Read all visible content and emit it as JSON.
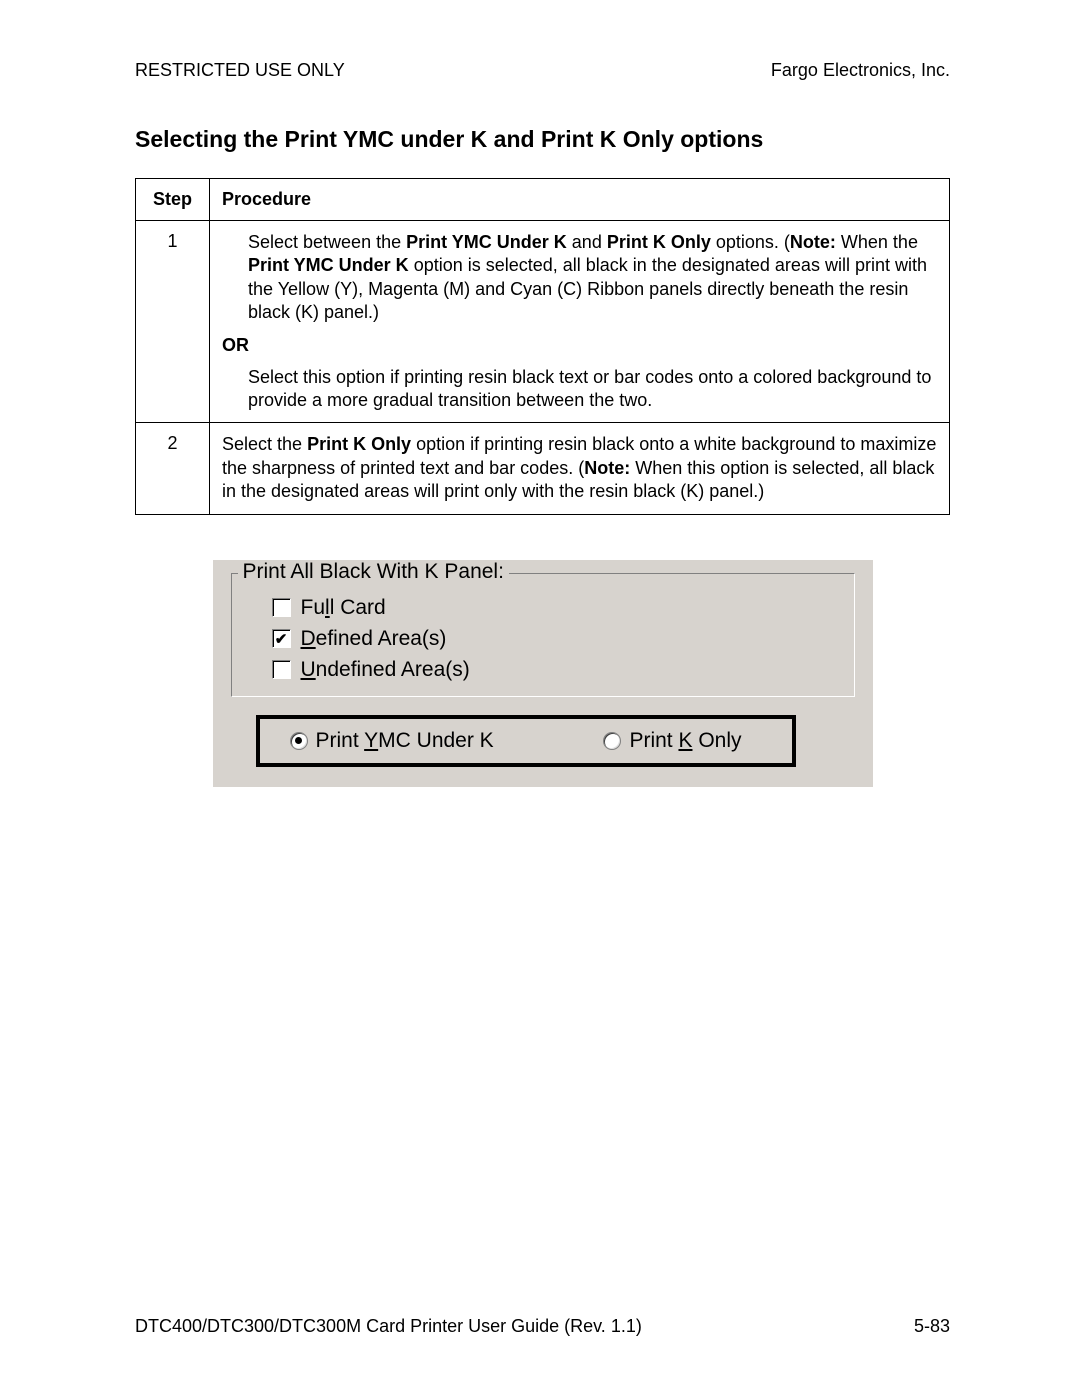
{
  "header": {
    "left": "RESTRICTED USE ONLY",
    "right": "Fargo Electronics, Inc."
  },
  "title": "Selecting the Print YMC under K and Print K Only options",
  "table": {
    "headers": {
      "step": "Step",
      "procedure": "Procedure"
    },
    "rows": [
      {
        "step": "1",
        "para1_pre": "Select between the ",
        "para1_b1": "Print YMC Under K",
        "para1_mid1": " and ",
        "para1_b2": "Print K Only",
        "para1_mid2": " options. (",
        "para1_b3": "Note:",
        "para1_mid3": " When the ",
        "para1_b4": "Print YMC Under K",
        "para1_post": " option is selected, all black in the designated areas will print with the Yellow (Y), Magenta (M) and Cyan (C) Ribbon panels directly beneath the resin black (K) panel.)",
        "or": "OR",
        "para2": "Select this option if printing resin black text or bar codes onto a colored background to provide a more gradual transition between the two."
      },
      {
        "step": "2",
        "para_pre": "Select the ",
        "para_b1": "Print K Only",
        "para_mid1": " option if printing resin black onto a white background to maximize the sharpness of printed text and bar codes. (",
        "para_b2": "Note:",
        "para_post": "  When this option is selected, all black in the designated areas will print only with the resin black (K) panel.)"
      }
    ]
  },
  "ui": {
    "legend": "Print All Black With K Panel:",
    "checks": [
      {
        "checked": false,
        "pre": "Fu",
        "u": "l",
        "post": "l Card"
      },
      {
        "checked": true,
        "pre": "",
        "u": "D",
        "post": "efined Area(s)"
      },
      {
        "checked": false,
        "pre": "",
        "u": "U",
        "post": "ndefined Area(s)"
      }
    ],
    "radios": [
      {
        "selected": true,
        "pre": "Print ",
        "u": "Y",
        "post": "MC Under K"
      },
      {
        "selected": false,
        "pre": "Print ",
        "u": "K",
        "post": " Only"
      }
    ]
  },
  "footer": {
    "left": "DTC400/DTC300/DTC300M Card Printer User Guide (Rev. 1.1)",
    "right": "5-83"
  }
}
